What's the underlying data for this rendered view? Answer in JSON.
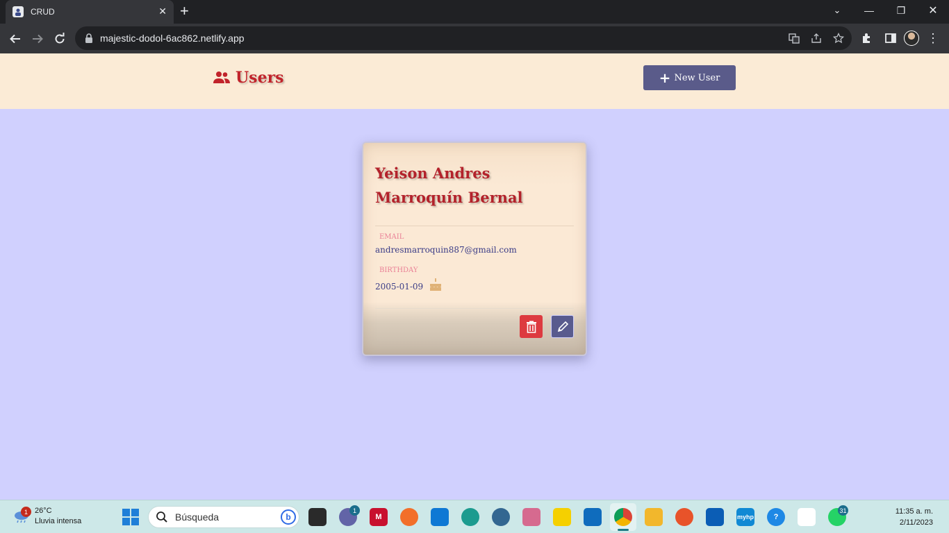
{
  "browser": {
    "tab_title": "CRUD",
    "url": "majestic-dodol-6ac862.netlify.app"
  },
  "header": {
    "title": "Users",
    "new_user_label": "New User"
  },
  "users": [
    {
      "name": "Yeison Andres Marroquín Bernal",
      "email_label": "EMAIL",
      "email": "andresmarroquin887@gmail.com",
      "birthday_label": "BIRTHDAY",
      "birthday": "2005-01-09"
    }
  ],
  "icons": {
    "header": "users-icon",
    "birthday": "cake-icon",
    "delete": "trash-icon",
    "edit": "pencil-icon"
  },
  "colors": {
    "page_bg": "#d0d0fe",
    "header_bg": "#fbebd6",
    "accent_red": "#c1232b",
    "button_purple": "#5a5b8a",
    "delete_red": "#dd3a40"
  },
  "taskbar": {
    "weather_temp": "26°C",
    "weather_desc": "Lluvia intensa",
    "weather_badge": "1",
    "search_placeholder": "Búsqueda",
    "teams_badge": "1",
    "whatsapp_badge": "31",
    "time": "11:35 a. m.",
    "date": "2/11/2023"
  }
}
